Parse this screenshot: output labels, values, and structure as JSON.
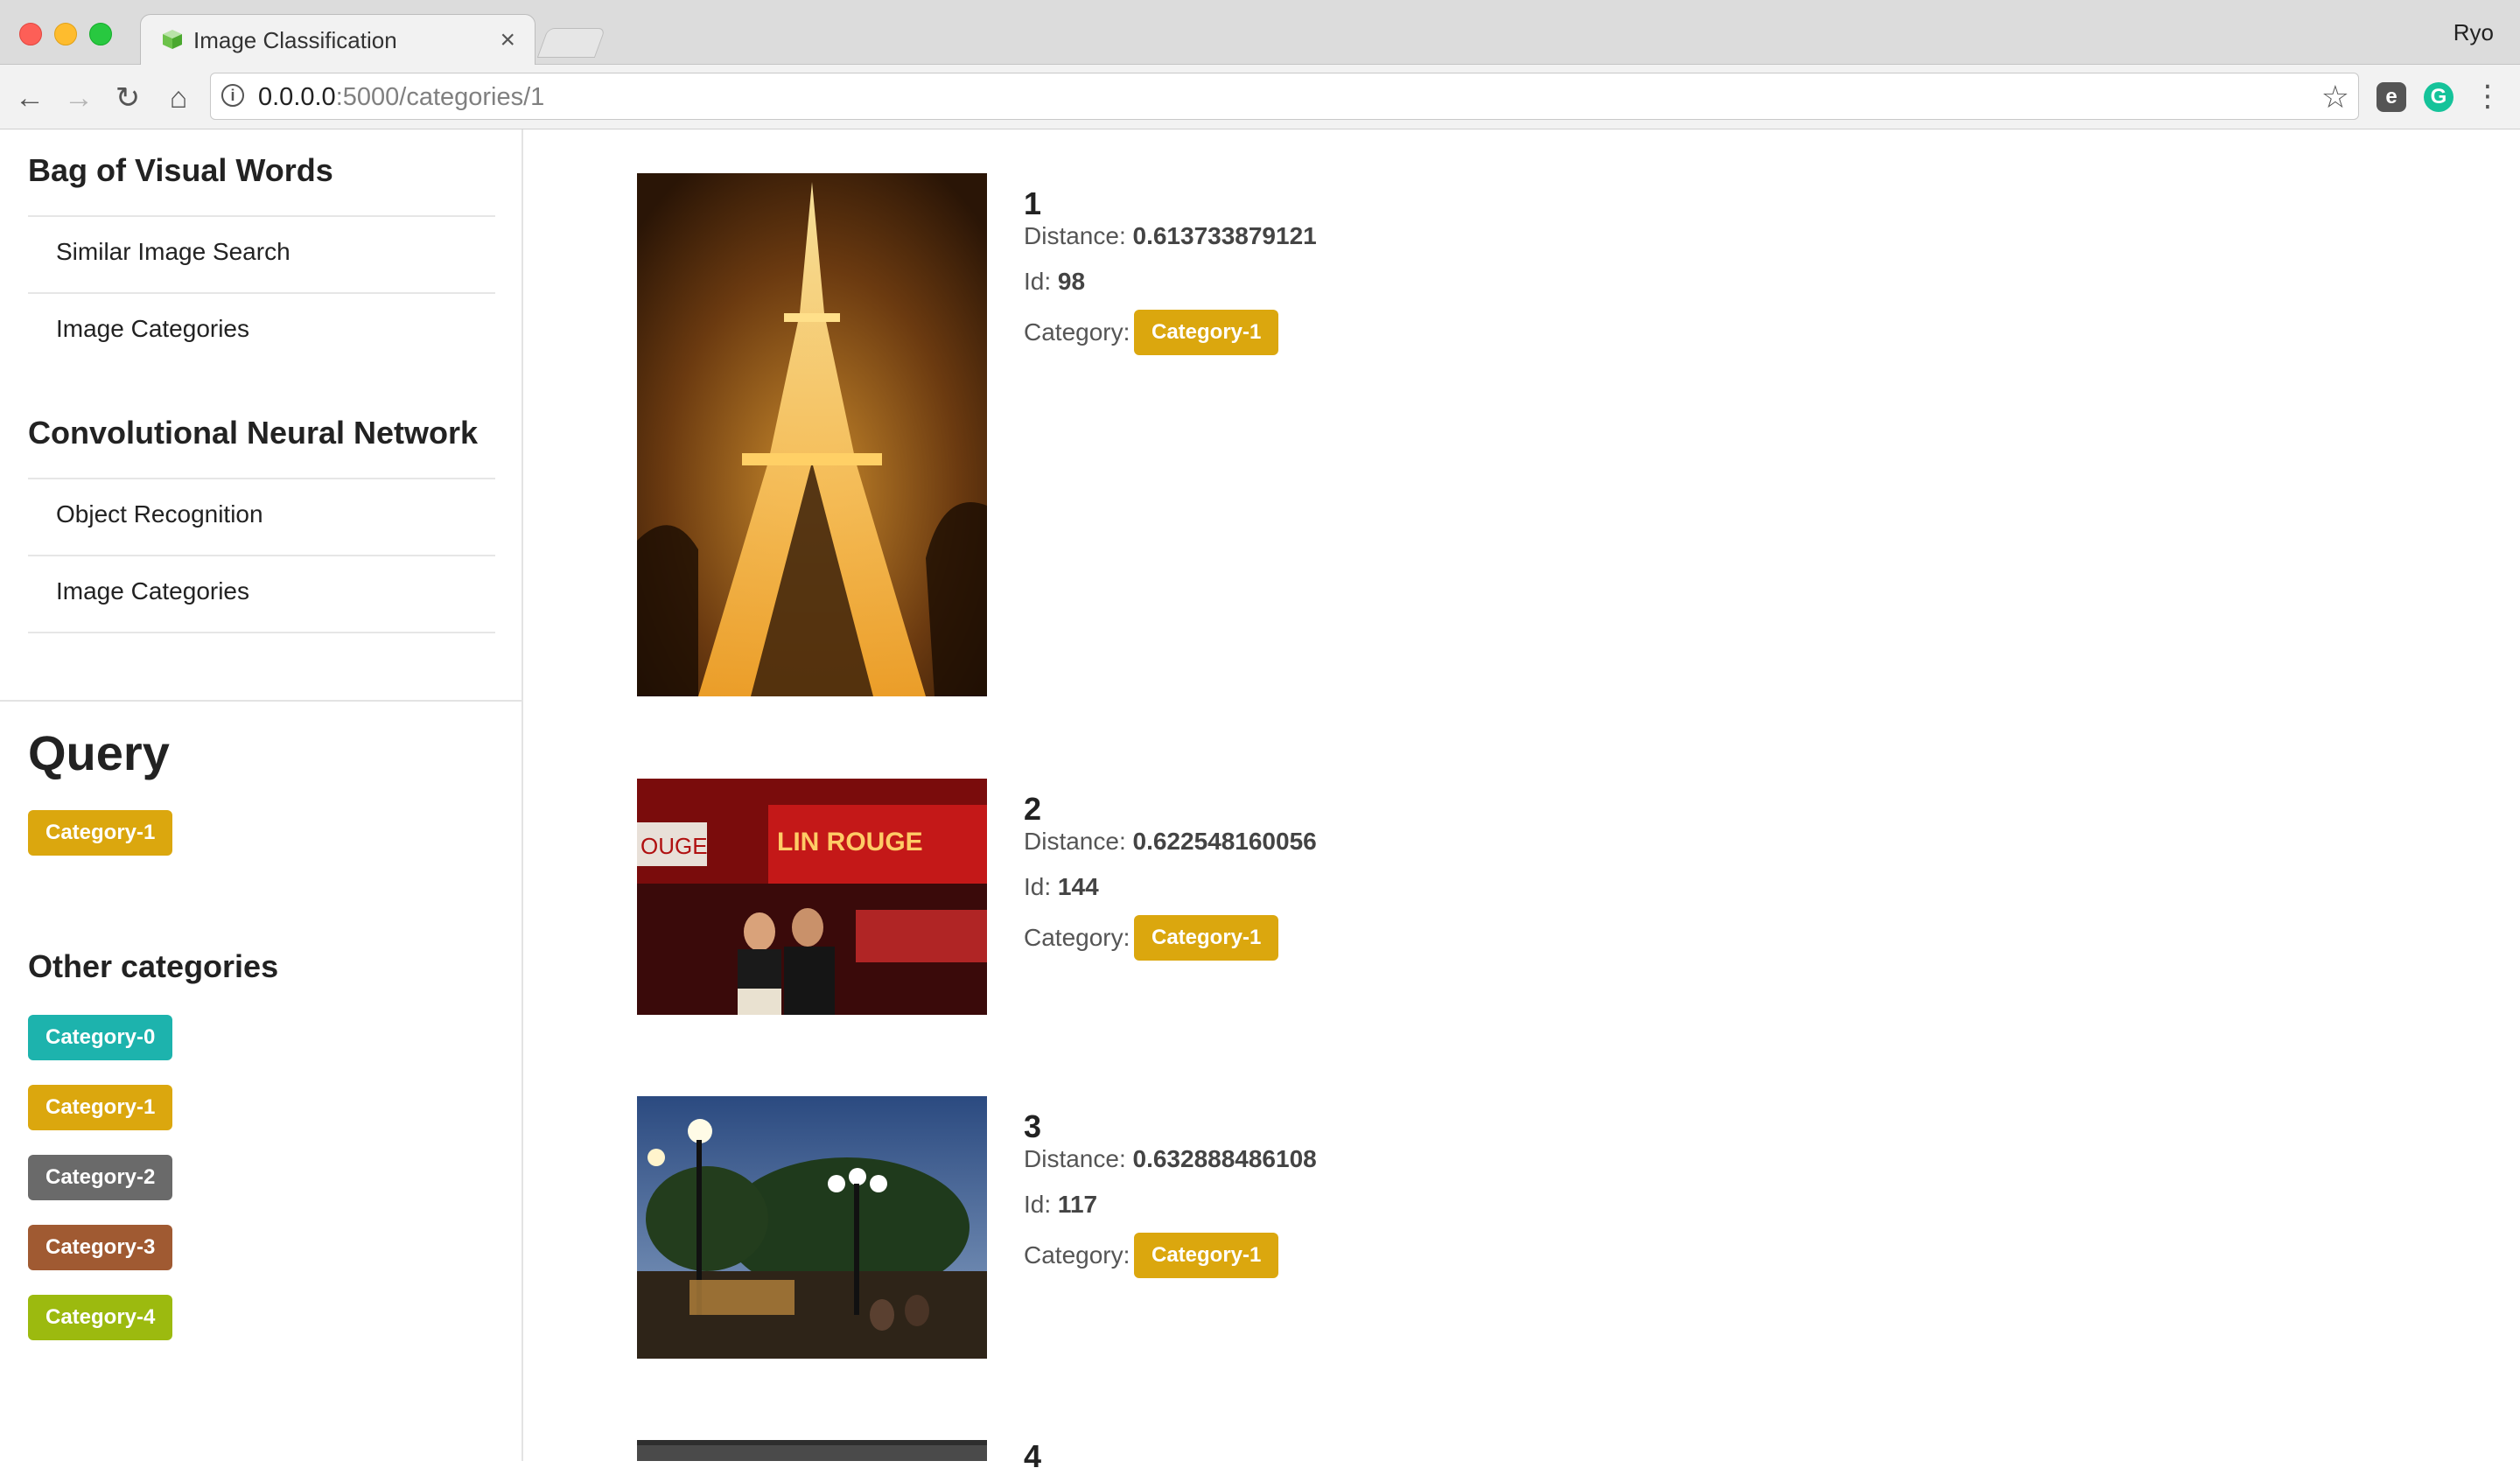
{
  "browser": {
    "tab_title": "Image Classification",
    "tab_close": "×",
    "profile_name": "Ryo",
    "url_host": "0.0.0.0",
    "url_path": ":5000/categories/1",
    "icons": [
      "back-arrow-icon",
      "forward-arrow-icon",
      "reload-icon",
      "home-icon",
      "info-icon",
      "star-icon",
      "evernote-icon",
      "grammarly-icon",
      "menu-dots-icon"
    ]
  },
  "sidebar": {
    "sections": [
      {
        "title": "Bag of Visual Words",
        "items": [
          {
            "label": "Similar Image Search"
          },
          {
            "label": "Image Categories"
          }
        ]
      },
      {
        "title": "Convolutional Neural Network",
        "items": [
          {
            "label": "Object Recognition"
          },
          {
            "label": "Image Categories"
          }
        ]
      }
    ],
    "query_title": "Query",
    "query_badge": {
      "label": "Category-1",
      "color": "#dba70e"
    },
    "other_title": "Other categories",
    "other_badges": [
      {
        "label": "Category-0",
        "color": "#1db3ad"
      },
      {
        "label": "Category-1",
        "color": "#dba70e"
      },
      {
        "label": "Category-2",
        "color": "#6a6a6a"
      },
      {
        "label": "Category-3",
        "color": "#a05a32"
      },
      {
        "label": "Category-4",
        "color": "#9cba0f"
      }
    ]
  },
  "results": [
    {
      "rank": "1",
      "distance_label": "Distance:",
      "distance": "0.613733879121",
      "id_label": "Id:",
      "id": "98",
      "category_label": "Category:",
      "category": "Category-1",
      "category_color": "#dba70e",
      "image_subject": "eiffel-tower-night"
    },
    {
      "rank": "2",
      "distance_label": "Distance:",
      "distance": "0.622548160056",
      "id_label": "Id:",
      "id": "144",
      "category_label": "Category:",
      "category": "Category-1",
      "category_color": "#dba70e",
      "image_subject": "moulin-rouge-couple",
      "image_text": [
        "OUGE",
        "LIN ROUGE"
      ]
    },
    {
      "rank": "3",
      "distance_label": "Distance:",
      "distance": "0.632888486108",
      "id_label": "Id:",
      "id": "117",
      "category_label": "Category:",
      "category": "Category-1",
      "category_color": "#dba70e",
      "image_subject": "street-lamps-evening"
    },
    {
      "rank": "4",
      "image_subject": "partially-visible-dark-image"
    }
  ]
}
